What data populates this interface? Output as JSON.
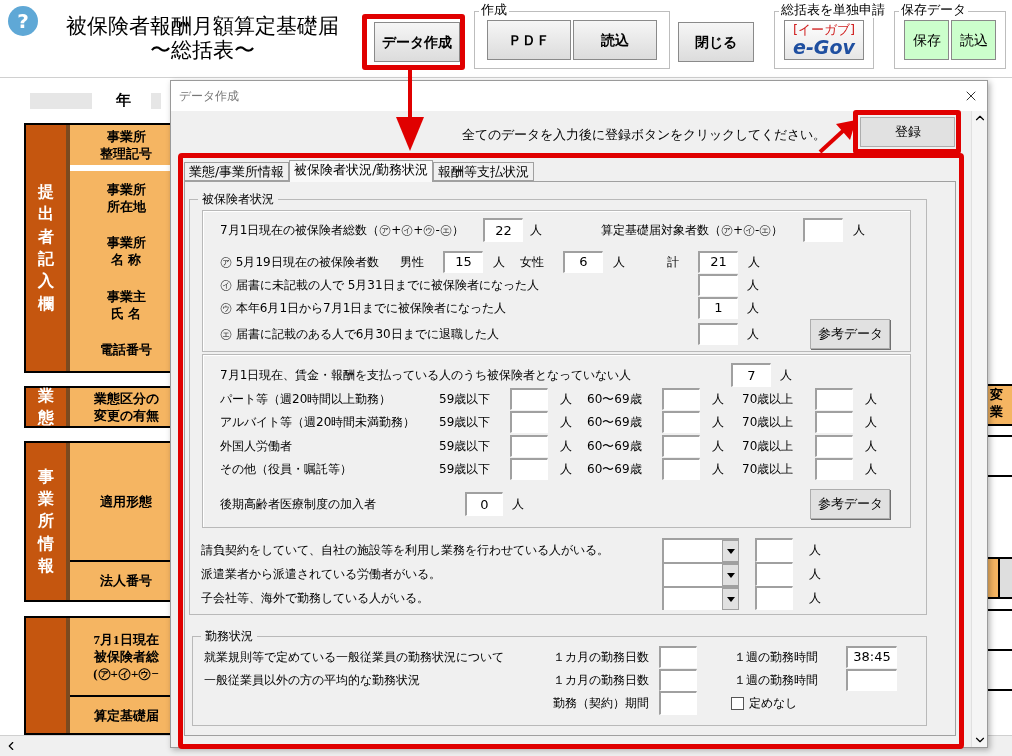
{
  "header": {
    "help": "?",
    "title_lines": [
      "被保険者報酬月額算定基礎届",
      "〜総括表〜"
    ],
    "data_button": "データ作成",
    "create_group": {
      "label": "作成",
      "buttons": [
        "ＰＤＦ",
        "読込"
      ]
    },
    "close_button": "閉じる",
    "egov_group": {
      "label": "総括表を単独申請",
      "logo_sub": "[イーガブ]",
      "logo": "e-Gov"
    },
    "save_group": {
      "label": "保存データ",
      "buttons": [
        "保存",
        "読込"
      ]
    }
  },
  "sheet": {
    "year_label": "年",
    "sections": [
      {
        "label": "提出者記入欄",
        "rows": [
          {
            "labels": [
              [
                "事業所",
                "整理記号"
              ]
            ]
          },
          {
            "labels": [
              [
                "事業所",
                "所在地"
              ],
              [
                "事業所",
                "名 称"
              ],
              [
                "事業主",
                "氏 名"
              ],
              [
                "電話番号"
              ]
            ]
          }
        ]
      },
      {
        "label": "業態",
        "rows": [
          {
            "labels": [
              [
                "業態区分の",
                "変更の有無"
              ]
            ]
          }
        ]
      },
      {
        "label": "事業所情報",
        "rows": [
          {
            "labels": [
              [
                "適用形態"
              ]
            ]
          },
          {
            "labels": [
              [
                "法人番号"
              ]
            ]
          }
        ]
      },
      {
        "rows": [
          {
            "labels": [
              [
                "7月1日現在",
                "被保険者総",
                "(㋐+㋑+㋒−"
              ]
            ]
          },
          {
            "labels": [
              [
                "算定基礎届"
              ]
            ]
          }
        ]
      }
    ],
    "right_cell": [
      "変",
      "業"
    ]
  },
  "dialog": {
    "title": "データ作成",
    "instruction": "全てのデータを入力後に登録ボタンをクリックしてください。",
    "register_button": "登録",
    "tabs": [
      {
        "label": "業態/事業所情報",
        "selected": false
      },
      {
        "label": "被保険者状況/勤務状況",
        "selected": true
      },
      {
        "label": "報酬等支払状況",
        "selected": false
      }
    ],
    "insured": {
      "title": "被保険者状況",
      "total": {
        "label": "7月1日現在の被保険者総数（㋐+㋑+㋒-㋓）",
        "value": "22",
        "unit": "人"
      },
      "target": {
        "label": "算定基礎届対象者数（㋐+㋑-㋓）",
        "unit": "人"
      },
      "breakdown": [
        {
          "kind": "gender",
          "label": "㋐ 5月19日現在の被保険者数",
          "parts": [
            {
              "label": "男性",
              "value": "15",
              "unit": "人"
            },
            {
              "label": "女性",
              "value": "6",
              "unit": "人"
            },
            {
              "label": "計",
              "value": "21",
              "unit": "人"
            }
          ]
        },
        {
          "kind": "single",
          "label": "㋑ 届書に未記載の人で 5月31日までに被保険者になった人",
          "unit": "人"
        },
        {
          "kind": "single",
          "label": "㋒ 本年6月1日から7月1日までに被保険者になった人",
          "value": "1",
          "unit": "人"
        },
        {
          "kind": "single",
          "label": "㋓ 届書に記載のある人で6月30日までに退職した人",
          "unit": "人"
        }
      ],
      "reference_button": "参考データ",
      "non_insured": {
        "label": "7月1日現在、賃金・報酬を支払っている人のうち被保険者となっていない人",
        "value": "7",
        "unit": "人"
      },
      "categories": [
        {
          "label": "パート等（週20時間以上勤務）",
          "ages": [
            {
              "label": "59歳以下",
              "unit": "人"
            },
            {
              "label": "60〜69歳",
              "unit": "人"
            },
            {
              "label": "70歳以上",
              "unit": "人"
            }
          ]
        },
        {
          "label": "アルバイト等（週20時間未満勤務）",
          "ages": [
            {
              "label": "59歳以下",
              "unit": "人"
            },
            {
              "label": "60〜69歳",
              "unit": "人"
            },
            {
              "label": "70歳以上",
              "unit": "人"
            }
          ]
        },
        {
          "label": "外国人労働者",
          "ages": [
            {
              "label": "59歳以下",
              "unit": "人"
            },
            {
              "label": "60〜69歳",
              "unit": "人"
            },
            {
              "label": "70歳以上",
              "unit": "人"
            }
          ]
        },
        {
          "label": "その他（役員・嘱託等）",
          "ages": [
            {
              "label": "59歳以下",
              "unit": "人"
            },
            {
              "label": "60〜69歳",
              "unit": "人"
            },
            {
              "label": "70歳以上",
              "unit": "人"
            }
          ]
        }
      ],
      "elderly": {
        "label": "後期高齢者医療制度の加入者",
        "value": "0",
        "unit": "人"
      },
      "reference_button_2": "参考データ",
      "questions": [
        {
          "label": "請負契約をしていて、自社の施設等を利用し業務を行わせている人がいる。",
          "unit": "人"
        },
        {
          "label": "派遣業者から派遣されている労働者がいる。",
          "unit": "人"
        },
        {
          "label": "子会社等、海外で勤務している人がいる。",
          "unit": "人"
        }
      ]
    },
    "work": {
      "title": "勤務状況",
      "rows": [
        {
          "label": "就業規則等で定めている一般従業員の勤務状況について",
          "days_label": "１カ月の勤務日数",
          "hours_label": "１週の勤務時間",
          "hours": "38:45"
        },
        {
          "label": "一般従業員以外の方の平均的な勤務状況",
          "days_label": "１カ月の勤務日数",
          "hours_label": "１週の勤務時間"
        }
      ],
      "period": {
        "label": "勤務（契約）期間",
        "checkbox": {
          "label": "定めなし",
          "checked": false
        }
      }
    }
  }
}
